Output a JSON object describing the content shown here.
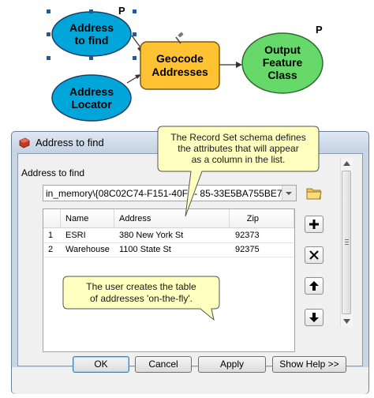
{
  "diagram": {
    "nodes": {
      "address_to_find": [
        "Address",
        "to find"
      ],
      "address_locator": [
        "Address",
        "Locator"
      ],
      "geocode": [
        "Geocode",
        "Addresses"
      ],
      "output": [
        "Output",
        "Feature",
        "Class"
      ]
    },
    "parameter_marker": "P",
    "colors": {
      "input_fill": "#00a6d9",
      "tool_fill": "#ffc233",
      "output_fill": "#66d96a"
    }
  },
  "dialog": {
    "title": "Address to find",
    "field_label": "Address to find",
    "path_value": "in_memory\\{08C02C74-F151-40FB-  85-33E5BA755BE7}",
    "table": {
      "columns": [
        "Name",
        "Address",
        "Zip"
      ],
      "rows": [
        {
          "num": "1",
          "name": "ESRI",
          "address": "380 New York St",
          "zip": "92373"
        },
        {
          "num": "2",
          "name": "Warehouse",
          "address": "1100 State St",
          "zip": "92375"
        }
      ]
    },
    "side_buttons": {
      "add": "plus-icon",
      "delete": "x-icon",
      "up": "arrow-up-icon",
      "down": "arrow-down-icon"
    },
    "buttons": {
      "ok": "OK",
      "cancel": "Cancel",
      "apply": "Apply",
      "help": "Show Help >>"
    }
  },
  "callouts": {
    "schema": [
      "The Record Set schema defines",
      "the attributes that will appear",
      "as a column in the list."
    ],
    "user": [
      "The user creates the table",
      "of addresses 'on-the-fly'."
    ]
  }
}
